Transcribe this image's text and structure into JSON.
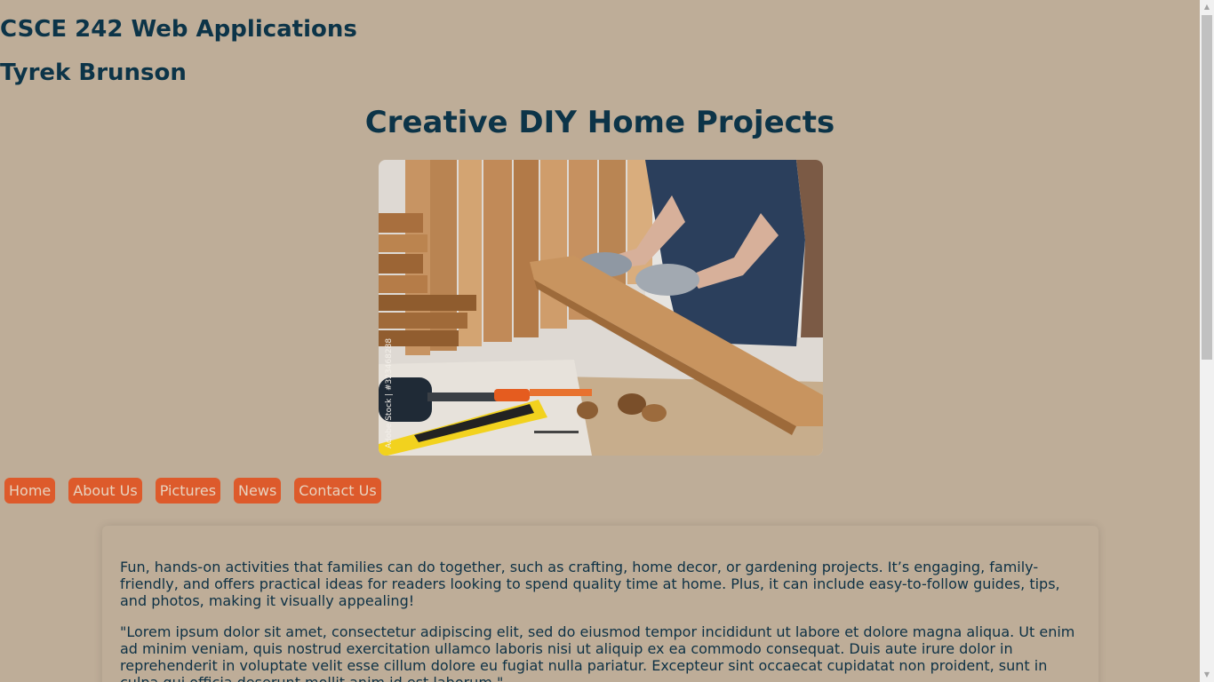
{
  "header": {
    "course": "CSCE 242 Web Applications",
    "author": "Tyrek Brunson",
    "title": "Creative DIY Home Projects"
  },
  "hero": {
    "description": "carpenter with gloves holding a wooden plank over a workbench with tools",
    "watermark": "Adobe Stock | #323468288"
  },
  "nav": {
    "items": [
      {
        "label": "Home"
      },
      {
        "label": "About Us"
      },
      {
        "label": "Pictures"
      },
      {
        "label": "News"
      },
      {
        "label": "Contact Us"
      }
    ]
  },
  "content": {
    "paragraph1": "Fun, hands-on activities that families can do together, such as crafting, home decor, or gardening projects. It’s engaging, family-friendly, and offers practical ideas for readers looking to spend quality time at home. Plus, it can include easy-to-follow guides, tips, and photos, making it visually appealing!",
    "paragraph2": "\"Lorem ipsum dolor sit amet, consectetur adipiscing elit, sed do eiusmod tempor incididunt ut labore et dolore magna aliqua. Ut enim ad minim veniam, quis nostrud exercitation ullamco laboris nisi ut aliquip ex ea commodo consequat. Duis aute irure dolor in reprehenderit in voluptate velit esse cillum dolore eu fugiat nulla pariatur. Excepteur sint occaecat cupidatat non proident, sunt in culpa qui officia deserunt mollit anim id est laborum.\""
  },
  "colors": {
    "background": "#bead98",
    "heading": "#0c3448",
    "nav_button": "#dd5a2b",
    "nav_text": "#e8d3bf"
  }
}
